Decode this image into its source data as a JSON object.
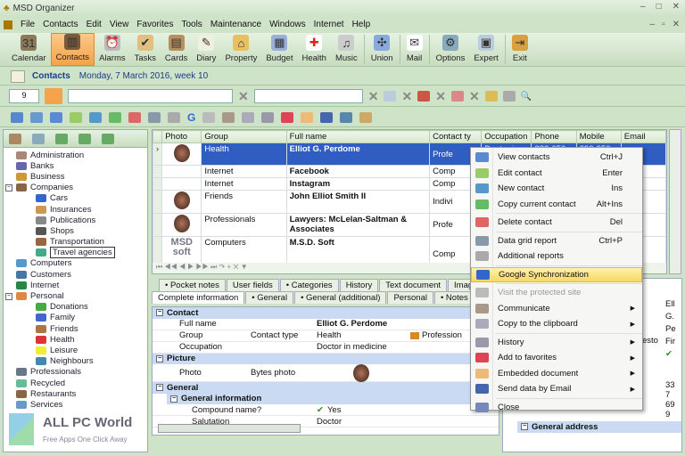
{
  "window": {
    "title": "MSD Organizer",
    "controls": [
      "–",
      "□",
      "✕"
    ]
  },
  "menu": [
    "File",
    "Contacts",
    "Edit",
    "View",
    "Favorites",
    "Tools",
    "Maintenance",
    "Windows",
    "Internet",
    "Help"
  ],
  "toolbar": [
    {
      "label": "Calendar",
      "icon": "calendar-icon",
      "color": "#8a7a5a",
      "glyph": "31"
    },
    {
      "label": "Contacts",
      "icon": "address-book-icon",
      "color": "#7a5a3a",
      "glyph": "▥",
      "active": true
    },
    {
      "label": "Alarms",
      "icon": "alarm-clock-icon",
      "color": "#bbb",
      "glyph": "⏰"
    },
    {
      "label": "Tasks",
      "icon": "checklist-icon",
      "color": "#e0c080",
      "glyph": "✔"
    },
    {
      "label": "Cards",
      "icon": "card-box-icon",
      "color": "#b89060",
      "glyph": "▤"
    },
    {
      "label": "Diary",
      "icon": "notepad-icon",
      "color": "#f0f0e0",
      "glyph": "✎"
    },
    {
      "label": "Property",
      "icon": "house-icon",
      "color": "#e8c060",
      "glyph": "⌂"
    },
    {
      "label": "Budget",
      "icon": "calculator-icon",
      "color": "#9ab0d8",
      "glyph": "▦"
    },
    {
      "label": "Health",
      "icon": "red-cross-icon",
      "color": "#fff",
      "glyph": "✚",
      "fg": "#d22"
    },
    {
      "label": "Music",
      "icon": "music-cd-icon",
      "color": "#ccc",
      "glyph": "♫"
    },
    {
      "label": "Union",
      "icon": "puzzle-icon",
      "color": "#8ad",
      "glyph": "✣"
    },
    {
      "label": "Mail",
      "icon": "envelope-icon",
      "color": "#fff",
      "glyph": "✉"
    },
    {
      "label": "Options",
      "icon": "options-icon",
      "color": "#8ab",
      "glyph": "⚙"
    },
    {
      "label": "Expert",
      "icon": "expert-window-icon",
      "color": "#bcd",
      "glyph": "▣"
    },
    {
      "label": "Exit",
      "icon": "exit-door-icon",
      "color": "#d9a040",
      "glyph": "⇥"
    }
  ],
  "context_bar": {
    "label": "Contacts",
    "date": "Monday, 7 March 2016, week 10"
  },
  "filter": {
    "count": "9",
    "combo1": "",
    "combo2": ""
  },
  "tree": [
    {
      "label": "Administration",
      "level": 0,
      "color": "#a87"
    },
    {
      "label": "Banks",
      "level": 0,
      "color": "#66a"
    },
    {
      "label": "Business",
      "level": 0,
      "color": "#c93"
    },
    {
      "label": "Companies",
      "level": 0,
      "color": "#864",
      "expanded": true
    },
    {
      "label": "Cars",
      "level": 1,
      "color": "#36c"
    },
    {
      "label": "Insurances",
      "level": 1,
      "color": "#c95"
    },
    {
      "label": "Publications",
      "level": 1,
      "color": "#888"
    },
    {
      "label": "Shops",
      "level": 1,
      "color": "#555"
    },
    {
      "label": "Transportation",
      "level": 1,
      "color": "#964"
    },
    {
      "label": "Travel agencies",
      "level": 1,
      "color": "#4a8",
      "selected": true
    },
    {
      "label": "Computers",
      "level": 0,
      "color": "#59c"
    },
    {
      "label": "Customers",
      "level": 0,
      "color": "#47a"
    },
    {
      "label": "Internet",
      "level": 0,
      "color": "#284"
    },
    {
      "label": "Personal",
      "level": 0,
      "color": "#d84",
      "expanded": true
    },
    {
      "label": "Donations",
      "level": 1,
      "color": "#4a4"
    },
    {
      "label": "Family",
      "level": 1,
      "color": "#46c"
    },
    {
      "label": "Friends",
      "level": 1,
      "color": "#a74"
    },
    {
      "label": "Health",
      "level": 1,
      "color": "#d33"
    },
    {
      "label": "Leisure",
      "level": 1,
      "color": "#ee3"
    },
    {
      "label": "Neighbours",
      "level": 1,
      "color": "#48a"
    },
    {
      "label": "Professionals",
      "level": 0,
      "color": "#678"
    },
    {
      "label": "Recycled",
      "level": 0,
      "color": "#6b9"
    },
    {
      "label": "Restaurants",
      "level": 0,
      "color": "#864"
    },
    {
      "label": "Services",
      "level": 0,
      "color": "#69c"
    }
  ],
  "grid": {
    "columns": [
      "Photo",
      "Group",
      "Full name",
      "Contact ty",
      "Occupation",
      "Phone",
      "Mobile",
      "Email"
    ],
    "rows": [
      {
        "photo": "face",
        "group": "Health",
        "name": "Elliot G. Perdome",
        "type": "Profe",
        "occupation": "Doctor in",
        "phone": "333-050-3",
        "mobile": "690-050-1",
        "email": "",
        "selected": true
      },
      {
        "photo": "",
        "group": "Internet",
        "name": "Facebook",
        "type": "Comp",
        "occupation": "",
        "phone": "",
        "mobile": "",
        "email": ""
      },
      {
        "photo": "",
        "group": "Internet",
        "name": "Instagram",
        "type": "Comp",
        "occupation": "",
        "phone": "",
        "mobile": "",
        "email": ""
      },
      {
        "photo": "face",
        "group": "Friends",
        "name": "John Elliot Smith II",
        "type": "Indivi",
        "occupation": "",
        "phone": "",
        "mobile": "",
        "email": ""
      },
      {
        "photo": "face",
        "group": "Professionals",
        "name": "Lawyers: McLelan-Saltman & Associates",
        "type": "Profe",
        "occupation": "",
        "phone": "",
        "mobile": "",
        "email": ""
      },
      {
        "photo": "logo",
        "group": "Computers",
        "name": "M.S.D. Soft",
        "type": "Comp",
        "occupation": "",
        "phone": "",
        "mobile": "",
        "email": ""
      }
    ],
    "logo_text": "MSD soft"
  },
  "tabs_row1": [
    "• Pocket notes",
    "User fields",
    "• Categories",
    "History",
    "Text document",
    "Image"
  ],
  "tabs_row2": [
    "Complete information",
    "• General",
    "• General (additional)",
    "Personal",
    "• Notes"
  ],
  "detail": {
    "contact_section": "Contact",
    "full_name_label": "Full name",
    "full_name": "Elliot G. Perdome",
    "group_label": "Group",
    "contact_type_label": "Contact type",
    "group": "Health",
    "contact_type": "Profession",
    "occupation_label": "Occupation",
    "occupation": "Doctor in medicine",
    "picture_section": "Picture",
    "photo_label": "Photo",
    "bytes_photo_label": "Bytes photo",
    "general_section": "General",
    "general_info_section": "General information",
    "compound_label": "Compound name?",
    "compound": "Yes",
    "salutation_label": "Salutation",
    "salutation": "Doctor"
  },
  "right_panel": {
    "values": [
      "Ell",
      "G.",
      "Pe",
      "Fir"
    ],
    "partial_label": "esto",
    "nums": [
      "33",
      "7",
      "69",
      "9"
    ],
    "general_address": "General address"
  },
  "context_menu": [
    {
      "label": "View contacts",
      "shortcut": "Ctrl+J",
      "icon": "monitor-icon",
      "color": "#5a8ad0"
    },
    {
      "label": "Edit contact",
      "shortcut": "Enter",
      "icon": "edit-icon",
      "color": "#9c6"
    },
    {
      "label": "New contact",
      "shortcut": "Ins",
      "icon": "new-contact-icon",
      "color": "#59c"
    },
    {
      "label": "Copy current contact",
      "shortcut": "Alt+Ins",
      "icon": "copy-contact-icon",
      "color": "#6b6",
      "sep": true
    },
    {
      "label": "Delete contact",
      "shortcut": "Del",
      "icon": "delete-contact-icon",
      "color": "#d66",
      "sep": true
    },
    {
      "label": "Data grid report",
      "shortcut": "Ctrl+P",
      "icon": "report-icon",
      "color": "#89a"
    },
    {
      "label": "Additional reports",
      "shortcut": "",
      "icon": "printer-icon",
      "color": "#aaa",
      "sep": true
    },
    {
      "label": "Google Synchronization",
      "shortcut": "",
      "icon": "google-icon",
      "color": "#36c",
      "highlighted": true,
      "sep": true
    },
    {
      "label": "Visit the protected site",
      "shortcut": "",
      "icon": "protected-site-icon",
      "color": "#bbb",
      "disabled": true
    },
    {
      "label": "Communicate",
      "shortcut": "",
      "icon": "communicate-icon",
      "color": "#a98",
      "submenu": true
    },
    {
      "label": "Copy to the clipboard",
      "shortcut": "",
      "icon": "clipboard-icon",
      "color": "#aab",
      "submenu": true,
      "sep": true
    },
    {
      "label": "History",
      "shortcut": "",
      "icon": "history-icon",
      "color": "#99a",
      "submenu": true
    },
    {
      "label": "Add to favorites",
      "shortcut": "",
      "icon": "favorites-heart-icon",
      "color": "#d45",
      "submenu": true
    },
    {
      "label": "Embedded document",
      "shortcut": "",
      "icon": "folder-icon",
      "color": "#eb7",
      "submenu": true
    },
    {
      "label": "Send data by Email",
      "shortcut": "",
      "icon": "email-icon",
      "color": "#46a",
      "submenu": true,
      "sep": true
    },
    {
      "label": "Close",
      "shortcut": "",
      "icon": "close-icon",
      "color": "#78b"
    }
  ],
  "watermark": {
    "title": "ALL PC World",
    "subtitle": "Free Apps One Click Away"
  }
}
